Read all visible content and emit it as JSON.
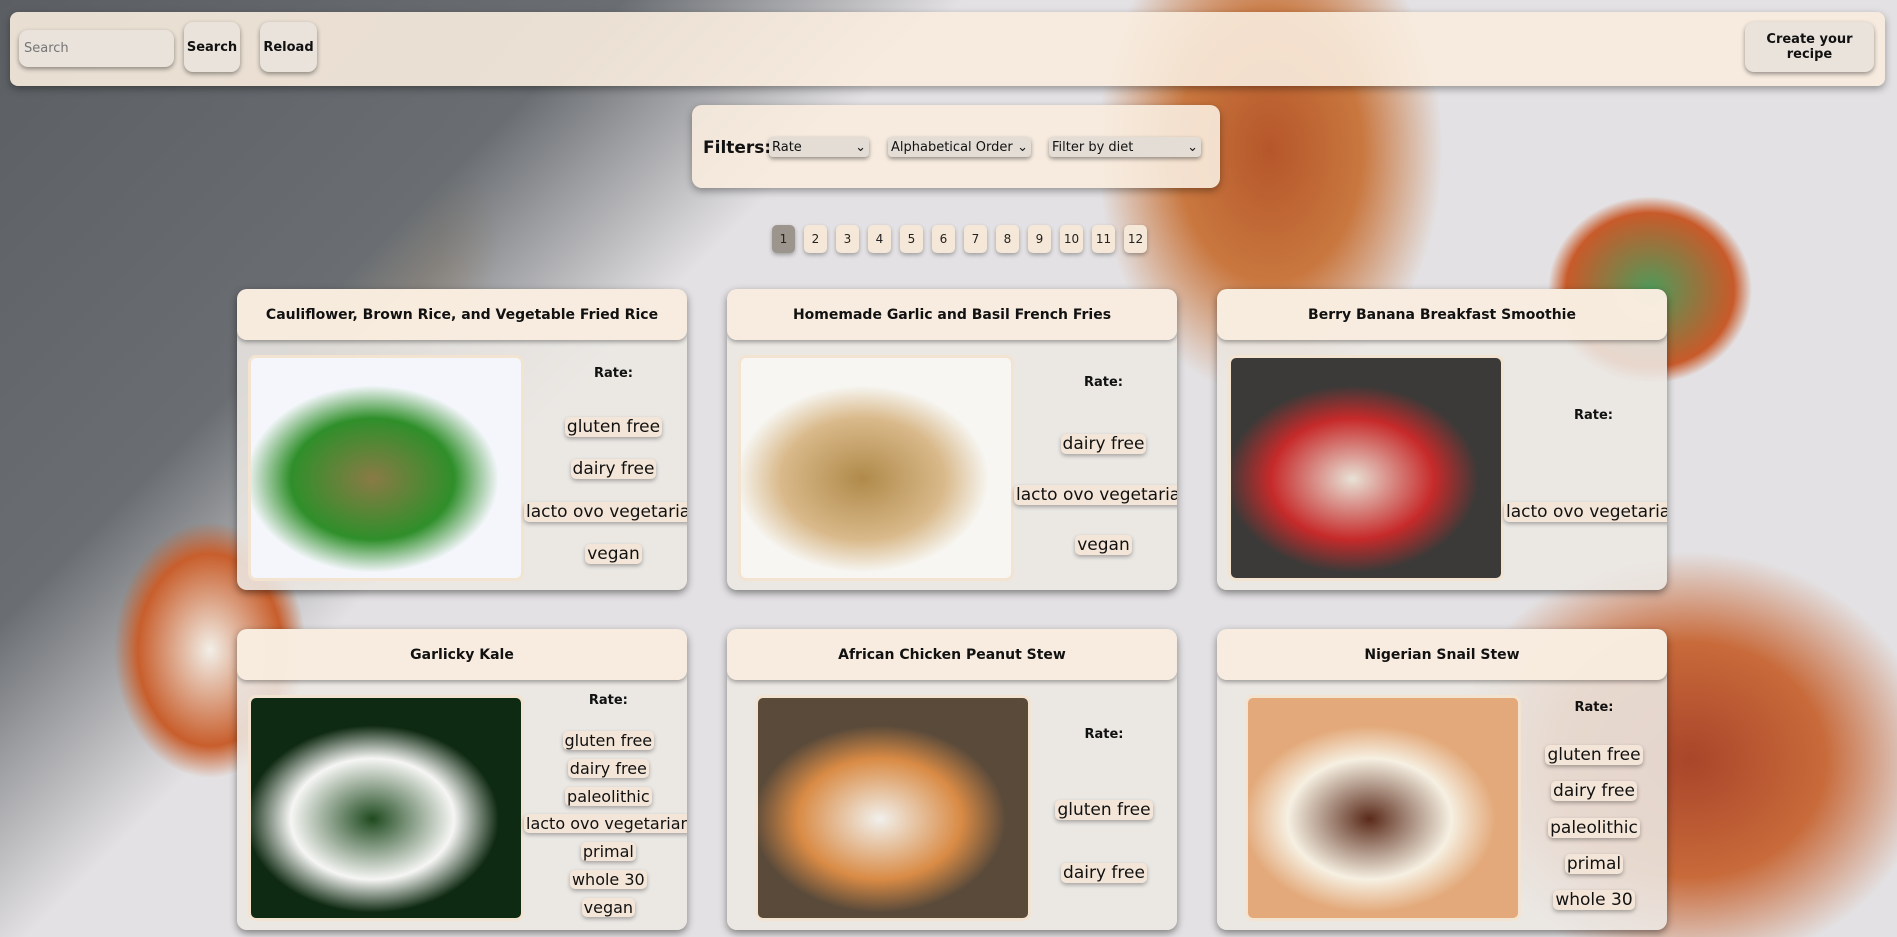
{
  "header": {
    "search_placeholder": "Search",
    "search_label": "Search",
    "reload_label": "Reload",
    "create_label": "Create your recipe"
  },
  "filters": {
    "label": "Filters:",
    "rate": "Rate",
    "order": "Alphabetical Order",
    "diet": "Filter by diet"
  },
  "pagination": {
    "pages": [
      "1",
      "2",
      "3",
      "4",
      "5",
      "6",
      "7",
      "8",
      "9",
      "10",
      "11",
      "12"
    ],
    "current": "1"
  },
  "recipes": [
    {
      "title": "Cauliflower, Brown Rice, and Vegetable Fried Rice",
      "rate_label": "Rate:",
      "diets": [
        "gluten free",
        "dairy free",
        "lacto ovo vegetarian",
        "vegan"
      ],
      "image_colors": [
        "#f4f6fb",
        "#8a7a45",
        "#2f8f2a"
      ]
    },
    {
      "title": "Homemade Garlic and Basil French Fries",
      "rate_label": "Rate:",
      "diets": [
        "dairy free",
        "lacto ovo vegetarian",
        "vegan"
      ],
      "image_colors": [
        "#f7f6f2",
        "#b08a4a",
        "#d9b98a"
      ]
    },
    {
      "title": "Berry Banana Breakfast Smoothie",
      "rate_label": "Rate:",
      "diets": [
        "lacto ovo vegetarian"
      ],
      "image_colors": [
        "#3b3a38",
        "#e8e2d6",
        "#c62a2a"
      ]
    },
    {
      "title": "Garlicky Kale",
      "rate_label": "Rate:",
      "diets": [
        "gluten free",
        "dairy free",
        "paleolithic",
        "lacto ovo vegetarian",
        "primal",
        "whole 30",
        "vegan"
      ],
      "image_colors": [
        "#0f2a12",
        "#1f4a1f",
        "#f6f6f4"
      ]
    },
    {
      "title": "African Chicken Peanut Stew",
      "rate_label": "Rate:",
      "diets": [
        "gluten free",
        "dairy free"
      ],
      "image_colors": [
        "#5a4a3a",
        "#f1f0ec",
        "#d98b45"
      ]
    },
    {
      "title": "Nigerian Snail Stew",
      "rate_label": "Rate:",
      "diets": [
        "gluten free",
        "dairy free",
        "paleolithic",
        "primal",
        "whole 30"
      ],
      "image_colors": [
        "#e3a97a",
        "#5a2a1a",
        "#f6f0e2"
      ]
    }
  ]
}
